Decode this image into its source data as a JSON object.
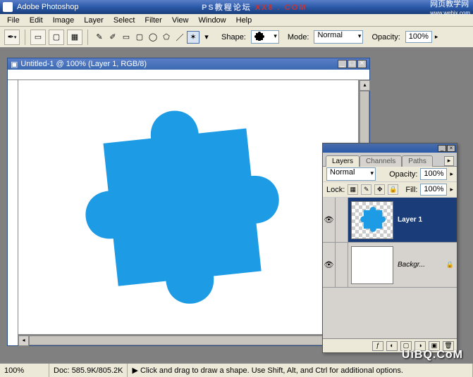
{
  "titlebar": {
    "app_name": "Adobe Photoshop",
    "center_text": "PS教程论坛",
    "center_suffix": "XX8 . COM",
    "right_text": "网页教学网",
    "right_url": "www.webjx.com"
  },
  "menubar": [
    "File",
    "Edit",
    "Image",
    "Layer",
    "Select",
    "Filter",
    "View",
    "Window",
    "Help"
  ],
  "options_bar": {
    "shape_label": "Shape:",
    "mode_label": "Mode:",
    "mode_value": "Normal",
    "opacity_label": "Opacity:",
    "opacity_value": "100%"
  },
  "doc_window": {
    "title": "Untitled-1 @ 100% (Layer 1, RGB/8)"
  },
  "layers_panel": {
    "tabs": [
      "Layers",
      "Channels",
      "Paths"
    ],
    "active_tab": 0,
    "blend_mode": "Normal",
    "opacity_label": "Opacity:",
    "opacity_value": "100%",
    "lock_label": "Lock:",
    "fill_label": "Fill:",
    "fill_value": "100%",
    "layers": [
      {
        "name": "Layer 1",
        "kind": "shape",
        "selected": true,
        "locked": false
      },
      {
        "name": "Backgr...",
        "kind": "background",
        "selected": false,
        "locked": true
      }
    ]
  },
  "statusbar": {
    "zoom": "100%",
    "doc_label": "Doc:",
    "doc_size": "585.9K/805.2K",
    "hint": "Click and drag to draw a shape.  Use Shift, Alt, and Ctrl for additional options."
  },
  "watermark": "UiBQ.CoM",
  "chart_data": {
    "type": "shape",
    "note": "Blue jigsaw puzzle piece vector shape on white canvas",
    "fill": "#1d9ce5"
  }
}
